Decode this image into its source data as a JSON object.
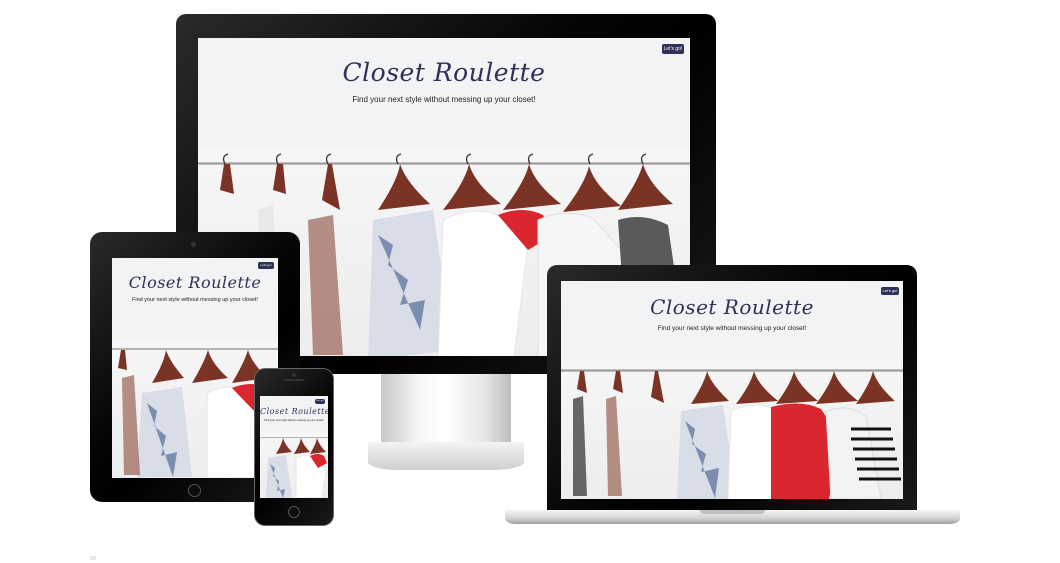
{
  "site": {
    "title": "Closet Roulette",
    "tagline": "Find your next style without messing up your closet!",
    "button_label": "Let's go!"
  },
  "devices": [
    "desktop-monitor",
    "tablet",
    "laptop",
    "phone"
  ],
  "colors": {
    "brand_navy": "#2e3158",
    "background": "#f2f3f5",
    "bezel": "#000000"
  },
  "icons": [
    "hanger-icon",
    "camera-icon",
    "home-button-icon"
  ]
}
